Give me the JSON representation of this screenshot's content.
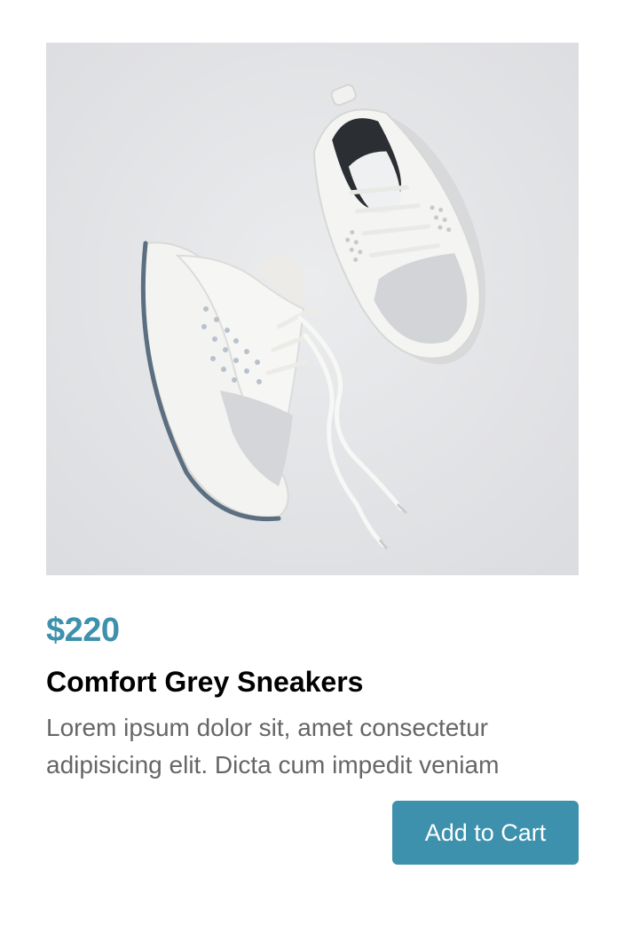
{
  "product": {
    "image_alt": "white mesh sneakers",
    "price": "$220",
    "name": "Comfort Grey Sneakers",
    "description": "Lorem ipsum dolor sit, amet consectetur adipisicing elit. Dicta cum impedit veniam",
    "cta_label": "Add to Cart"
  },
  "colors": {
    "accent": "#3d91ad",
    "image_background": "#e3e4e6",
    "description_text": "#666666"
  }
}
